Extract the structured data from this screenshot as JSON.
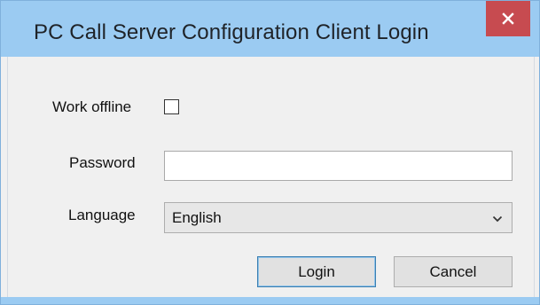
{
  "window": {
    "title": "PC Call Server Configuration Client Login"
  },
  "form": {
    "work_offline_label": "Work offline",
    "work_offline_checked": false,
    "password_label": "Password",
    "password_value": "",
    "language_label": "Language",
    "language_selected": "English"
  },
  "buttons": {
    "login_label": "Login",
    "cancel_label": "Cancel"
  },
  "icons": {
    "close": "close-icon",
    "dropdown": "chevron-down-icon"
  },
  "colors": {
    "titlebar": "#9bcbf2",
    "close_button": "#c74b50",
    "dialog_background": "#f0f0f0",
    "default_button_border": "#3c7fb1"
  }
}
